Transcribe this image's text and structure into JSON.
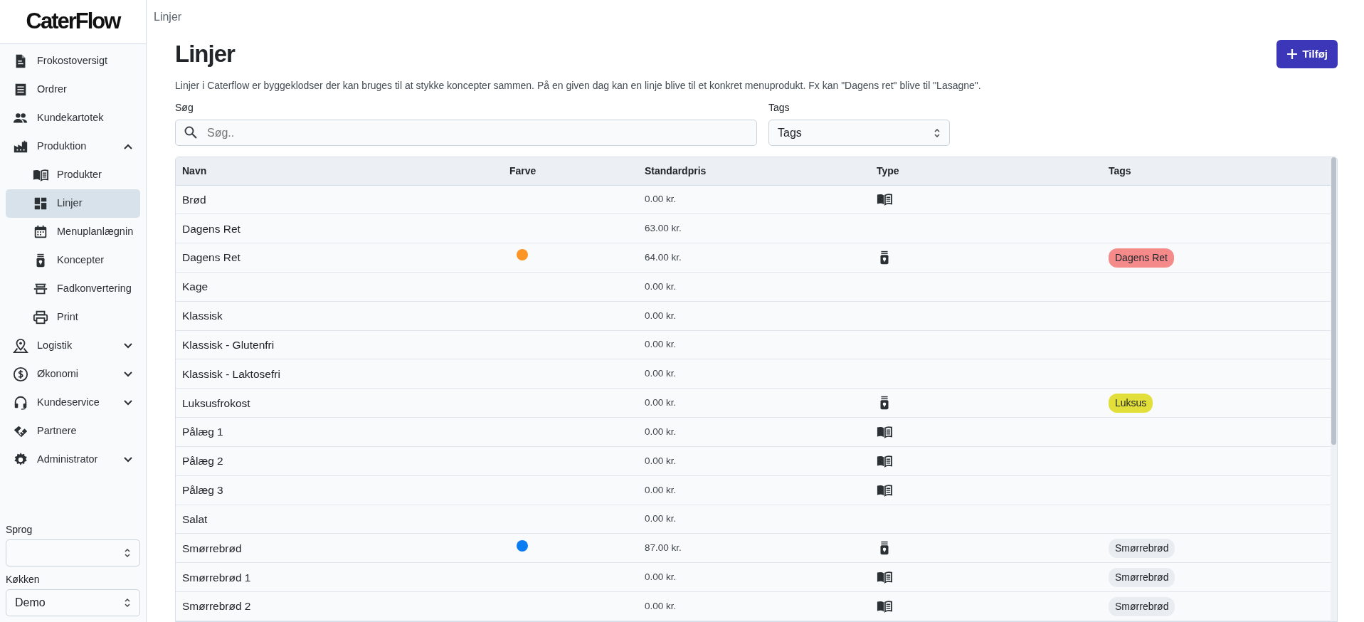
{
  "logo": {
    "text": "CaterFlow"
  },
  "sidebar": {
    "items": [
      {
        "label": "Frokostoversigt",
        "selected": false
      },
      {
        "label": "Ordrer",
        "selected": false
      },
      {
        "label": "Kundekartotek",
        "selected": false
      },
      {
        "label": "Produktion",
        "selected": false,
        "expanded": true,
        "children": [
          {
            "label": "Produkter",
            "selected": false
          },
          {
            "label": "Linjer",
            "selected": true
          },
          {
            "label": "Menuplanlægnin",
            "selected": false
          },
          {
            "label": "Koncepter",
            "selected": false
          },
          {
            "label": "Fadkonvertering",
            "selected": false
          },
          {
            "label": "Print",
            "selected": false
          }
        ]
      },
      {
        "label": "Logistik",
        "selected": false,
        "expanded": false
      },
      {
        "label": "Økonomi",
        "selected": false,
        "expanded": false
      },
      {
        "label": "Kundeservice",
        "selected": false,
        "expanded": false
      },
      {
        "label": "Partnere",
        "selected": false
      },
      {
        "label": "Administrator",
        "selected": false,
        "expanded": false
      }
    ],
    "language": {
      "label": "Sprog"
    },
    "kitchen": {
      "label": "Køkken",
      "value": "Demo"
    }
  },
  "breadcrumb": "Linjer",
  "page": {
    "title": "Linjer",
    "add_button": "Tilføj",
    "description": "Linjer i Caterflow er byggeklodser der kan bruges til at stykke koncepter sammen. På en given dag kan en linje blive til et konkret menuprodukt. Fx kan \"Dagens ret\" blive til \"Lasagne\".",
    "search": {
      "label": "Søg",
      "placeholder": "Søg.."
    },
    "tags_filter": {
      "label": "Tags",
      "value": "Tags"
    }
  },
  "table": {
    "columns": [
      "Navn",
      "Farve",
      "Standardpris",
      "Type",
      "Tags"
    ],
    "rows": [
      {
        "name": "Brød",
        "price": "0.00 kr.",
        "kind": "product"
      },
      {
        "name": "Dagens Ret",
        "price": "63.00 kr."
      },
      {
        "name": "Dagens Ret",
        "color": "#fd9426",
        "price": "64.00 kr.",
        "kind": "concept",
        "tags": [
          {
            "label": "Dagens Ret",
            "color": "#f58a8a"
          }
        ]
      },
      {
        "name": "Kage",
        "price": "0.00 kr."
      },
      {
        "name": "Klassisk",
        "price": "0.00 kr."
      },
      {
        "name": "Klassisk - Glutenfri",
        "price": "0.00 kr."
      },
      {
        "name": "Klassisk - Laktosefri",
        "price": "0.00 kr."
      },
      {
        "name": "Luksusfrokost",
        "price": "0.00 kr.",
        "kind": "concept",
        "tags": [
          {
            "label": "Luksus",
            "color": "#e3df3a"
          }
        ]
      },
      {
        "name": "Pålæg 1",
        "price": "0.00 kr.",
        "kind": "product"
      },
      {
        "name": "Pålæg 2",
        "price": "0.00 kr.",
        "kind": "product"
      },
      {
        "name": "Pålæg 3",
        "price": "0.00 kr.",
        "kind": "product"
      },
      {
        "name": "Salat",
        "price": "0.00 kr."
      },
      {
        "name": "Smørrebrød",
        "color": "#0a7cf2",
        "price": "87.00 kr.",
        "kind": "concept",
        "tags": [
          {
            "label": "Smørrebrød",
            "color": "#e9edf1"
          }
        ]
      },
      {
        "name": "Smørrebrød 1",
        "price": "0.00 kr.",
        "kind": "product",
        "tags": [
          {
            "label": "Smørrebrød",
            "color": "#e9edf1"
          }
        ]
      },
      {
        "name": "Smørrebrød 2",
        "price": "0.00 kr.",
        "kind": "product",
        "tags": [
          {
            "label": "Smørrebrød",
            "color": "#e9edf1"
          }
        ]
      }
    ]
  }
}
